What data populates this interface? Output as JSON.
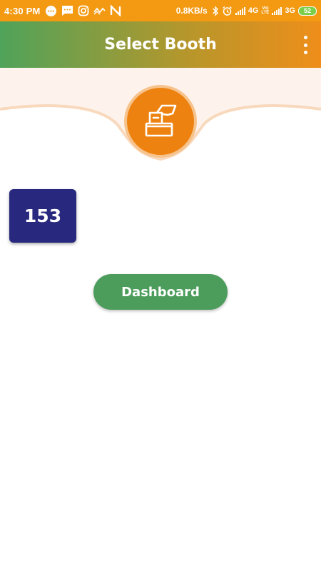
{
  "status_bar": {
    "time": "4:30 PM",
    "net_speed": "0.8KB/s",
    "network_1": "4G",
    "volte": [
      "Vo)",
      "LTE"
    ],
    "network_2": "3G",
    "battery": "52",
    "icons": [
      "chat-icon",
      "sms-icon",
      "instagram-icon",
      "wave-icon",
      "n-app-icon",
      "bluetooth-icon",
      "alarm-icon",
      "signal-icon",
      "signal-icon",
      "battery-icon"
    ]
  },
  "app_bar": {
    "title": "Select Booth",
    "menu_icon": "more-vert-icon",
    "gradient": [
      "#4fa35a",
      "#ef8e1a"
    ]
  },
  "emblem": {
    "icon": "ballot-box-vote-icon",
    "color": "#ed8210"
  },
  "booths": [
    {
      "number": "153",
      "color": "#27287e"
    }
  ],
  "dashboard_button": {
    "label": "Dashboard",
    "color": "#4c9d5c"
  }
}
